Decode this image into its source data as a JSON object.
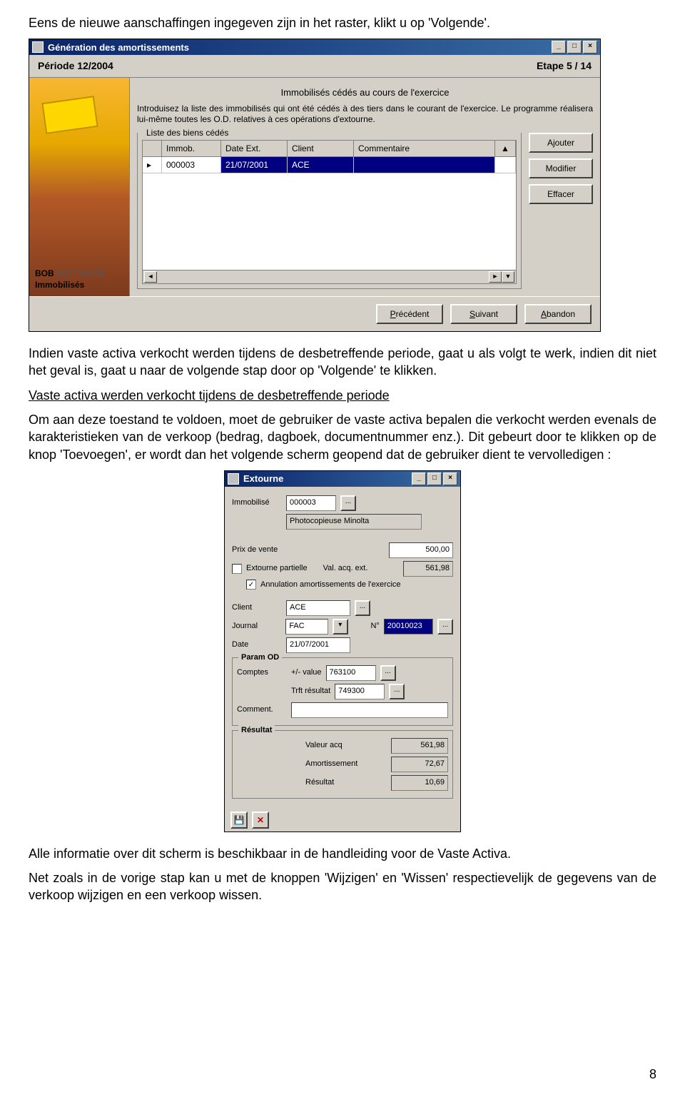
{
  "intro": "Eens de nieuwe aanschaffingen ingegeven zijn in het raster, klikt u op 'Volgende'.",
  "win1": {
    "title": "Génération des amortissements",
    "period_label": "Période  12/2004",
    "step_label": "Etape  5 / 14",
    "subtitle": "Immobilisés cédés au cours de l'exercice",
    "instr": "Introduisez la liste des immobilisés qui ont été cédés à des tiers dans le courant de l'exercice. Le programme réalisera lui-même toutes les O.D. relatives à ces opérations d'extourne.",
    "group_label": "Liste des biens cédés",
    "cols": {
      "c1": "Immob.",
      "c2": "Date Ext.",
      "c3": "Client",
      "c4": "Commentaire"
    },
    "row": {
      "immob": "000003",
      "date": "21/07/2001",
      "client": "ACE",
      "comment": ""
    },
    "btns": {
      "add": "Ajouter",
      "mod": "Modifier",
      "del": "Effacer"
    },
    "brand1": "BOB",
    "brand2": " SOFTWARE",
    "brand3": "Immobilisés",
    "wizard": {
      "prev_pre": "P",
      "prev": "récédent",
      "next_pre": "S",
      "next": "uivant",
      "abort_pre": "A",
      "abort": "bandon"
    }
  },
  "para2": "Indien vaste activa verkocht werden tijdens de desbetreffende periode, gaat u als volgt te werk, indien dit niet het geval is, gaat u naar de volgende stap door op 'Volgende' te klikken.",
  "heading": "Vaste activa werden verkocht tijdens de desbetreffende periode",
  "para3": "Om aan deze toestand te voldoen, moet de gebruiker de vaste activa bepalen die verkocht werden evenals de karakteristieken van de verkoop (bedrag, dagboek, documentnummer enz.).  Dit gebeurt door te klikken op de knop 'Toevoegen', er wordt dan het volgende scherm geopend dat de gebruiker dient te vervolledigen :",
  "dlg": {
    "title": "Extourne",
    "immob_label": "Immobilisé",
    "immob_val": "000003",
    "immob_desc": "Photocopieuse Minolta",
    "prix_label": "Prix de vente",
    "prix_val": "500,00",
    "ext_part": "Extourne partielle",
    "val_acq_label": "Val. acq. ext.",
    "val_acq": "561,98",
    "annul": "Annulation amortissements de l'exercice",
    "client_label": "Client",
    "client_val": "ACE",
    "journal_label": "Journal",
    "journal_val": "FAC",
    "num_label": "N°",
    "num_val": "20010023",
    "date_label": "Date",
    "date_val": "21/07/2001",
    "param_label": "Param OD",
    "comptes_label": "Comptes",
    "plusmin": "+/- value",
    "comptes_val": "763100",
    "trft_label": "Trft résultat",
    "trft_val": "749300",
    "comment_label": "Comment.",
    "result_label": "Résultat",
    "vacq_label": "Valeur acq",
    "vacq_val": "561,98",
    "amort_label": "Amortissement",
    "amort_val": "72,67",
    "res_label": "Résultat",
    "res_val": "10,69"
  },
  "para4": "Alle informatie over dit scherm is beschikbaar in de handleiding voor de Vaste Activa.",
  "para5": "Net zoals in de vorige stap kan u met de knoppen 'Wijzigen' en 'Wissen' respectievelijk de gegevens van de verkoop wijzigen en een verkoop wissen.",
  "page_num": "8",
  "glyphs": {
    "min": "_",
    "max": "□",
    "close": "×",
    "up": "▲",
    "down": "▼",
    "left": "◄",
    "right": "►",
    "check": "✓",
    "save": "💾",
    "del": "✕",
    "tri": "▸",
    "dd": "▾"
  }
}
